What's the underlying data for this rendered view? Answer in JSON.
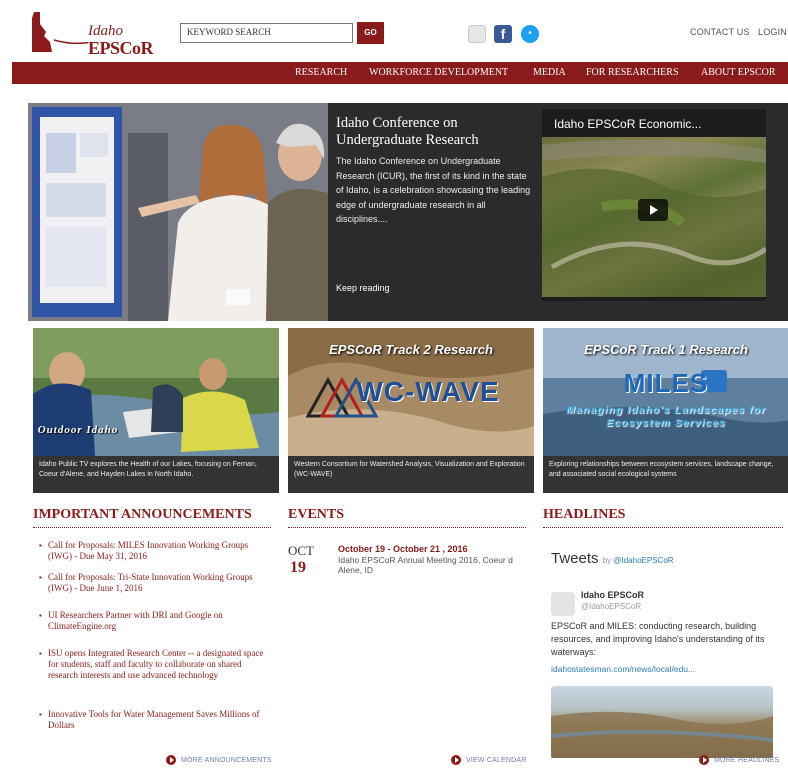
{
  "header": {
    "logo_line1": "Idaho",
    "logo_line2": "EPSCoR",
    "search_placeholder": "KEYWORD SEARCH",
    "go_label": "GO",
    "social": [
      "mail-icon",
      "facebook-icon",
      "twitter-icon"
    ],
    "fb_glyph": "f",
    "tw_glyph": "•",
    "contact_label": "CONTACT US",
    "login_label": "LOGIN"
  },
  "nav": {
    "items": [
      "RESEARCH",
      "WORKFORCE DEVELOPMENT",
      "MEDIA",
      "FOR RESEARCHERS",
      "ABOUT EPSCOR"
    ]
  },
  "hero": {
    "title": "Idaho Conference on Undergraduate Research",
    "body": "The Idaho Conference on Undergraduate Research (ICUR), the first of its kind in the state of Idaho, is a celebration showcasing the leading edge of undergraduate research in all disciplines....",
    "keep_reading": "Keep reading",
    "video_title": "Idaho EPSCoR Economic..."
  },
  "tiles": [
    {
      "brand": "Outdoor Idaho",
      "caption": "Idaho Public TV explores the Health of our Lakes, focusing on Fernan, Coeur d'Alene, and Hayden Lakes in North Idaho."
    },
    {
      "overlay_title": "EPSCoR Track 2 Research",
      "brand": "WC-WAVE",
      "caption": "Western Consortium for Watershed Analysis, Visualization and Exploration (WC-WAVE)"
    },
    {
      "overlay_title": "EPSCoR Track 1 Research",
      "brand": "MILES",
      "subtitle": "Managing Idaho's Landscapes for Ecosystem Services",
      "caption": "Exploring relationships between ecosystem services, landscape change, and associated social ecological systems"
    }
  ],
  "announcements": {
    "heading": "IMPORTANT ANNOUNCEMENTS",
    "items": [
      "Call for Proposals: MILES Innovation Working Groups (IWG) - Due May 31, 2016",
      "Call for Proposals: Tri-State Innovation Working Groups (IWG) - Due June 1, 2016",
      "UI Researchers Partner with DRI and Google on ClimateEngine.org",
      "ISU opens Integrated Research Center -- a designated space for students, staff and faculty to collaborate on shared research interests and use advanced technology",
      "Innovative Tools for Water Management Saves Millions of Dollars"
    ],
    "more_label": "MORE ANNOUNCEMENTS"
  },
  "events": {
    "heading": "EVENTS",
    "month": "OCT",
    "day": "19",
    "date_range": "October 19 - October 21 , 2016",
    "description": "Idaho EPSCoR Annual Meeting 2016, Coeur d Alene, ID",
    "more_label": "VIEW CALENDAR"
  },
  "headlines": {
    "heading": "HEADLINES",
    "tweets_label": "Tweets",
    "tweets_by": "by",
    "tweets_handle": "@IdahoEPSCoR",
    "tweet_name": "Idaho EPSCoR",
    "tweet_handle": "@IdahoEPSCoR",
    "tweet_body": "EPSCoR and MILES: conducting research, building resources, and improving Idaho's understanding of its waterways:",
    "tweet_link": "idahostatesman.com/news/local/edu...",
    "more_label": "MORE HEADLINES"
  },
  "colors": {
    "brand": "#8b1a1a",
    "link": "#2b7bb9"
  }
}
